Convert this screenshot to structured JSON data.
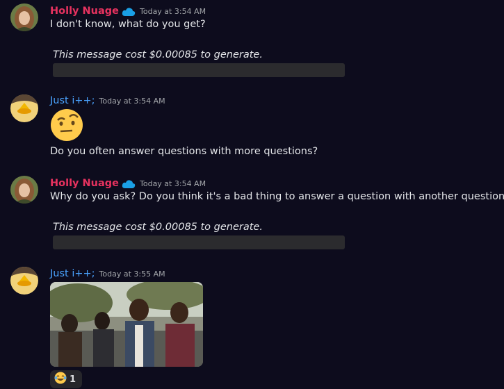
{
  "messages": [
    {
      "author": "Holly Nuage",
      "author_color": "#e7325f",
      "badge": "cloud-badge-icon",
      "timestamp": "Today at 3:54 AM",
      "text": "I don't know, what do you get?",
      "note": "This message cost $0.00085 to generate."
    },
    {
      "author": "Just i++;",
      "author_color": "#4aa3ff",
      "timestamp": "Today at 3:54 AM",
      "emoji": "raised-eyebrow-emoji",
      "text": "Do you often answer questions with more questions?"
    },
    {
      "author": "Holly Nuage",
      "author_color": "#e7325f",
      "badge": "cloud-badge-icon",
      "timestamp": "Today at 3:54 AM",
      "text": "Why do you ask? Do you think it's a bad thing to answer a question with another question?",
      "note": "This message cost $0.00085 to generate."
    },
    {
      "author": "Just i++;",
      "author_color": "#4aa3ff",
      "timestamp": "Today at 3:55 AM",
      "attachment": "gif-image",
      "reaction": {
        "emoji": "joy-emoji",
        "count": "1"
      }
    }
  ]
}
